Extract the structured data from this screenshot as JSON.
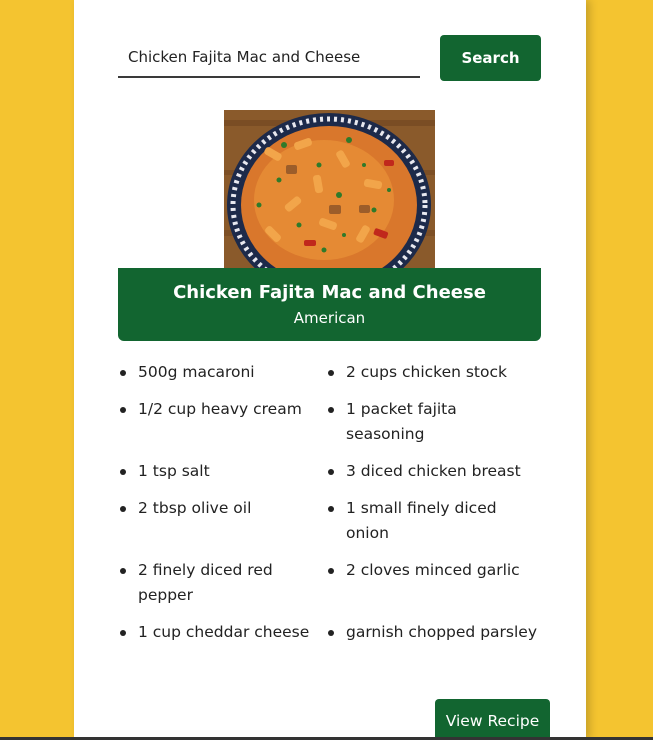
{
  "search": {
    "value": "Chicken Fajita Mac and Cheese",
    "button_label": "Search"
  },
  "recipe": {
    "title": "Chicken Fajita Mac and Cheese",
    "cuisine": "American",
    "ingredients": [
      "500g macaroni",
      "2 cups chicken stock",
      "1/2 cup heavy cream",
      "1 packet fajita seasoning",
      "1 tsp salt",
      "3 diced chicken breast",
      "2 tbsp olive oil",
      "1 small finely diced onion",
      "2 finely diced red pepper",
      "2 cloves minced garlic",
      "1 cup cheddar cheese",
      "garnish chopped parsley"
    ],
    "view_button_label": "View Recipe"
  },
  "colors": {
    "background": "#f4c430",
    "accent": "#126530",
    "card": "#ffffff"
  }
}
